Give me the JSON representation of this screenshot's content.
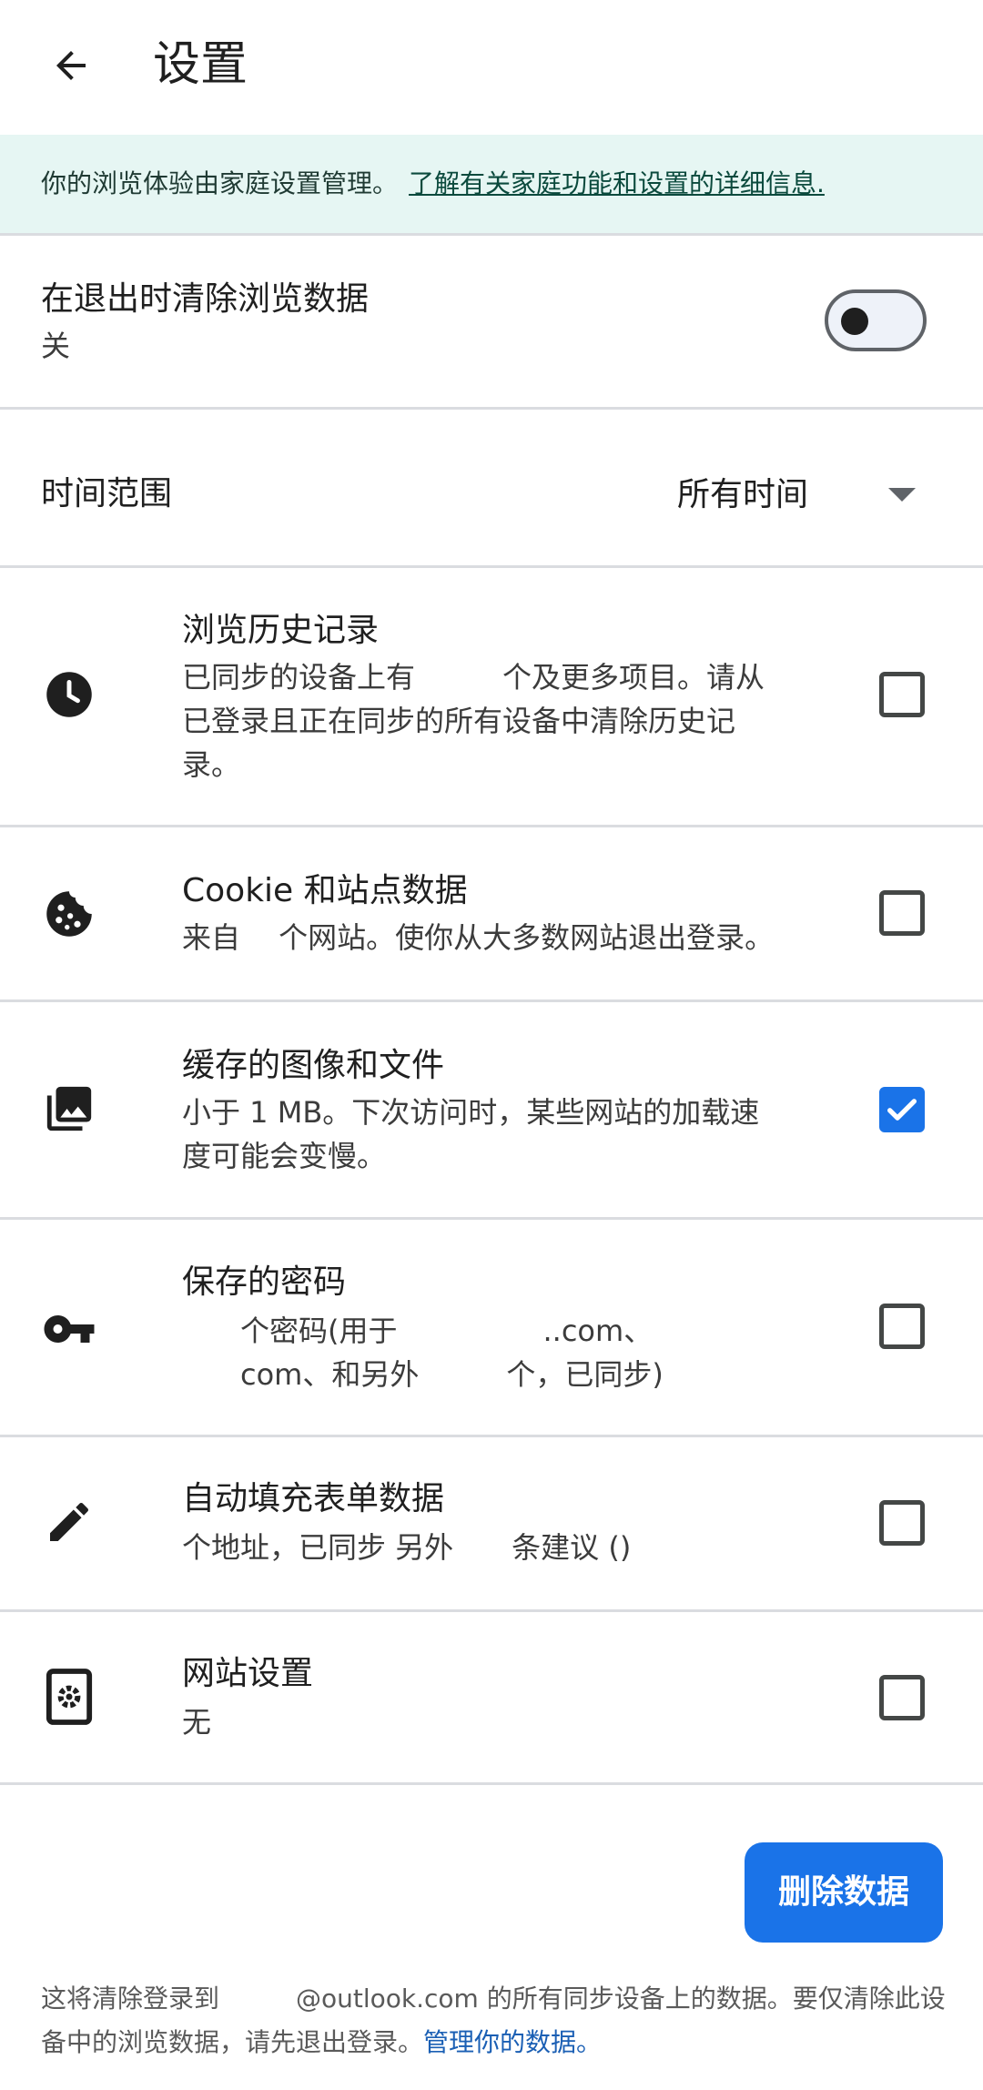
{
  "header": {
    "title": "设置"
  },
  "banner": {
    "text": "你的浏览体验由家庭设置管理。",
    "link": "了解有关家庭功能和设置的详细信息."
  },
  "clear_on_exit": {
    "title": "在退出时清除浏览数据",
    "status": "关",
    "enabled": false
  },
  "time_range": {
    "label": "时间范围",
    "value": "所有时间"
  },
  "items": [
    {
      "title": "浏览历史记录",
      "sub_line1": "已同步的设备上有　　　个及更多项目。请从",
      "sub_line2": "已登录且正在同步的所有设备中清除历史记",
      "sub_line3": "录。",
      "icon": "clock-icon",
      "checked": false
    },
    {
      "title": "Cookie 和站点数据",
      "sub_line1": "来自　 个网站。使你从大多数网站退出登录。",
      "icon": "cookie-icon",
      "checked": false
    },
    {
      "title": "缓存的图像和文件",
      "sub_line1": "小于 1 MB。下次访问时，某些网站的加载速",
      "sub_line2": "度可能会变慢。",
      "icon": "images-icon",
      "checked": true
    },
    {
      "title": "保存的密码",
      "sub_line1": "　　个密码(用于　　　　　..com、",
      "sub_line2": "　　com、和另外　　　个，已同步)",
      "icon": "key-icon",
      "checked": false
    },
    {
      "title": "自动填充表单数据",
      "sub_line1": " 个地址，已同步 另外　　条建议 ()",
      "icon": "pencil-icon",
      "checked": false
    },
    {
      "title": "网站设置",
      "sub_line1": "无",
      "icon": "site-settings-icon",
      "checked": false
    }
  ],
  "delete_button": {
    "label": "删除数据"
  },
  "footer": {
    "text": "这将清除登录到　　　@outlook.com 的所有同步设备上的数据。要仅清除此设备中的浏览数据，请先退出登录。",
    "link": "管理你的数据。"
  },
  "colors": {
    "accent": "#1a73e8",
    "banner_bg": "#e6f6f3",
    "divider": "#dadce0"
  }
}
